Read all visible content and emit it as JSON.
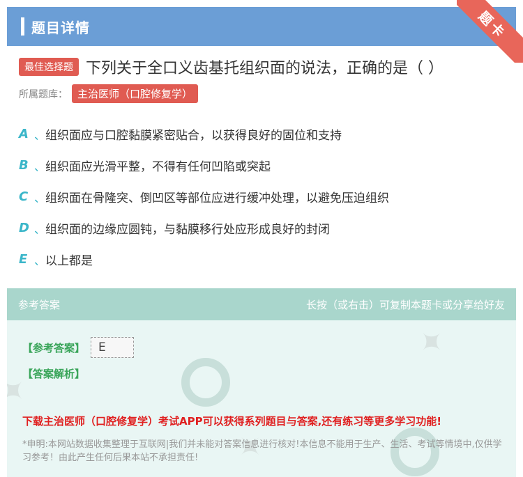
{
  "header": {
    "title": "题目详情"
  },
  "ribbon": {
    "label": "题卡"
  },
  "question": {
    "type_badge": "最佳选择题",
    "text": "下列关于全口义齿基托组织面的说法，正确的是（ ）"
  },
  "library": {
    "label": "所属题库：",
    "tag": "主治医师（口腔修复学）"
  },
  "options": [
    {
      "letter": "A",
      "sep": "、",
      "text": "组织面应与口腔黏膜紧密贴合，以获得良好的固位和支持"
    },
    {
      "letter": "B",
      "sep": "、",
      "text": "组织面应光滑平整，不得有任何凹陷或突起"
    },
    {
      "letter": "C",
      "sep": "、",
      "text": "组织面在骨隆突、倒凹区等部位应进行缓冲处理，以避免压迫组织"
    },
    {
      "letter": "D",
      "sep": "、",
      "text": "组织面的边缘应圆钝，与黏膜移行处应形成良好的封闭"
    },
    {
      "letter": "E",
      "sep": "、",
      "text": "以上都是"
    }
  ],
  "answer": {
    "head_left": "参考答案",
    "head_right": "长按（或右击）可复制本题卡或分享给好友",
    "answer_label": "【参考答案】",
    "answer_value": "E",
    "analysis_label": "【答案解析】",
    "promo": "下载主治医师（口腔修复学）考试APP可以获得系列题目与答案,还有练习等更多学习功能!",
    "disclaimer": "*申明:本网站数据收集整理于互联网|我们并未能对答案信息进行核对!本信息不能用于生产、生活、考试等情境中,仅供学习参考！由此产生任何后果本站不承担责任!"
  },
  "colors": {
    "header_bg": "#6b9ed6",
    "badge_red": "#e05b52",
    "option_letter": "#3bb6c9",
    "answer_head_bg": "#a9d6cc",
    "answer_panel_bg": "#e9f6f4",
    "answer_label_green": "#3aa55a",
    "promo_red": "#e02020"
  },
  "icons": {
    "watermark": "tiku-watermark-logo"
  }
}
